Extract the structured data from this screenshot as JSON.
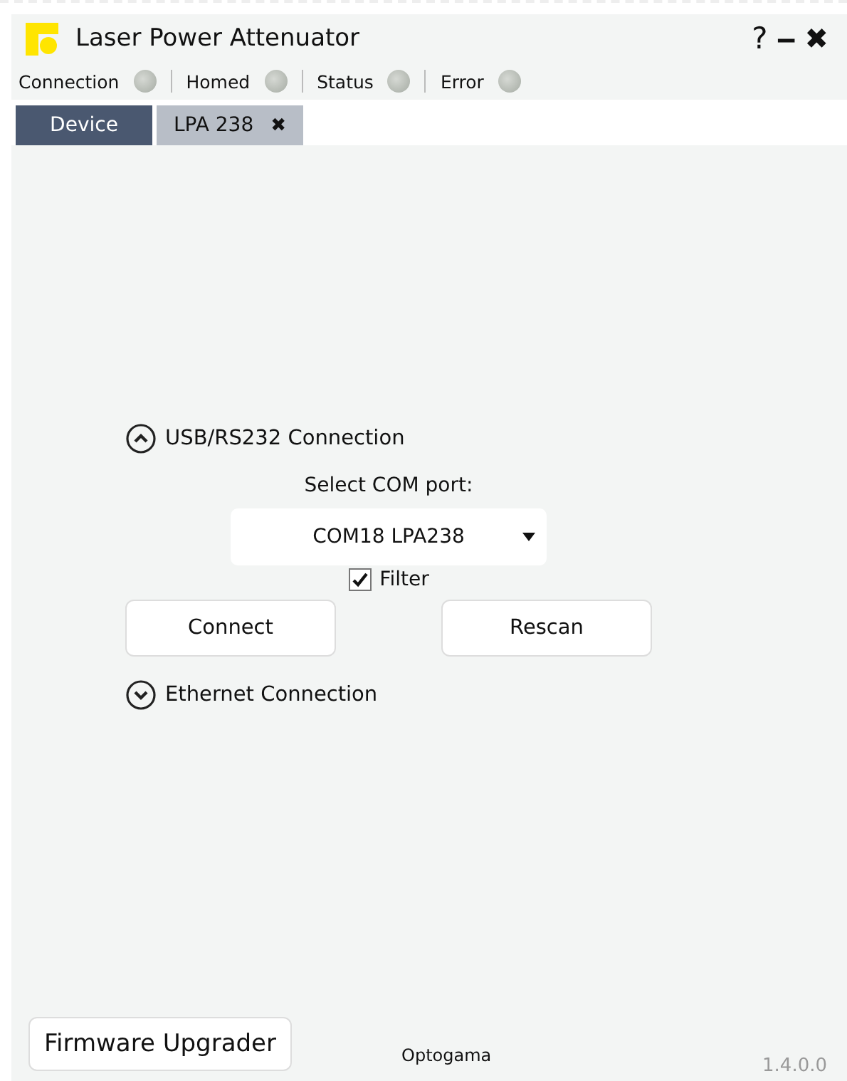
{
  "window": {
    "title": "Laser Power Attenuator",
    "help": "?",
    "minimize": "‒",
    "close": "✖"
  },
  "indicators": [
    {
      "label": "Connection",
      "on": false
    },
    {
      "label": "Homed",
      "on": false
    },
    {
      "label": "Status",
      "on": false
    },
    {
      "label": "Error",
      "on": false
    }
  ],
  "tabs": [
    {
      "label": "Device",
      "selected": true
    },
    {
      "label": "LPA 238",
      "selected": false,
      "close": "✖"
    }
  ],
  "sections": [
    {
      "title": "USB/RS232 Connection",
      "expanded": true,
      "port_label": "Select COM port:",
      "port_value": "COM18 LPA238",
      "filter": {
        "label": "Filter",
        "checked": true
      },
      "buttons": [
        "Connect",
        "Rescan"
      ]
    },
    {
      "title": "Ethernet Connection",
      "expanded": false
    }
  ],
  "footer": {
    "button": "Firmware Upgrader",
    "brand": "Optogama",
    "version": "1.4.0.0"
  }
}
